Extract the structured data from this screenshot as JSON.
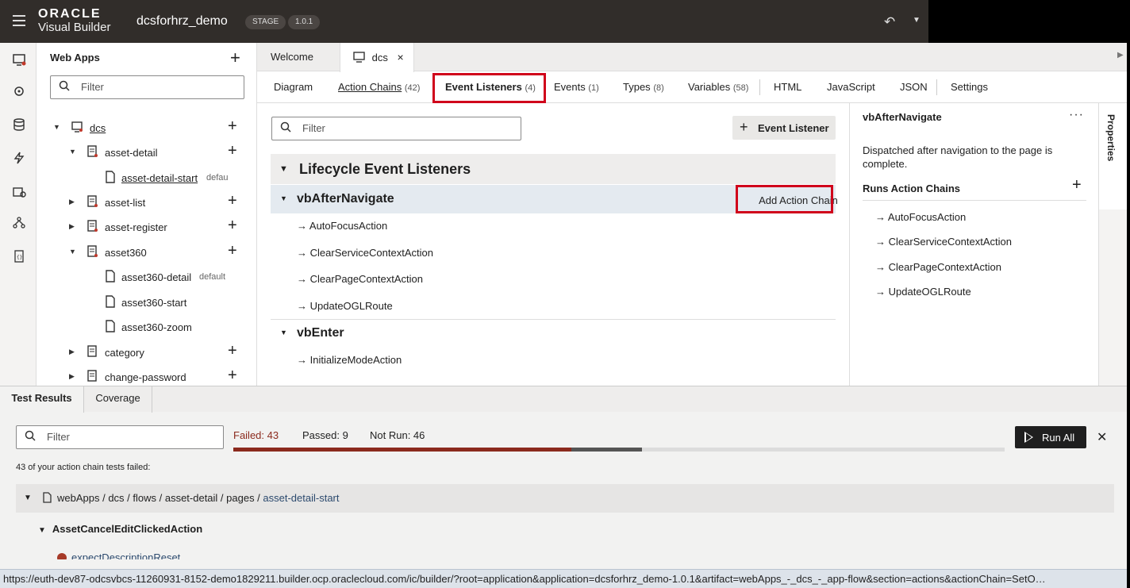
{
  "topbar": {
    "logo_line1": "ORACLE",
    "logo_line2": "Visual Builder",
    "app_name": "dcsforhrz_demo",
    "badge_stage": "STAGE",
    "badge_version": "1.0.1"
  },
  "sidebar": {
    "title": "Web Apps",
    "filter_placeholder": "Filter",
    "items": [
      {
        "label": "dcs"
      },
      {
        "label": "asset-detail"
      },
      {
        "label": "asset-detail-start",
        "note": "defau"
      },
      {
        "label": "asset-list"
      },
      {
        "label": "asset-register"
      },
      {
        "label": "asset360"
      },
      {
        "label": "asset360-detail",
        "note": "default"
      },
      {
        "label": "asset360-start"
      },
      {
        "label": "asset360-zoom"
      },
      {
        "label": "category"
      },
      {
        "label": "change-password"
      }
    ]
  },
  "file_tabs": {
    "welcome": "Welcome",
    "dcs": "dcs",
    "close": "×"
  },
  "sub_tabs": [
    {
      "label": "Diagram",
      "count": ""
    },
    {
      "label": "Action Chains",
      "count": "(42)"
    },
    {
      "label": "Event Listeners",
      "count": "(4)"
    },
    {
      "label": "Events",
      "count": "(1)"
    },
    {
      "label": "Types",
      "count": "(8)"
    },
    {
      "label": "Variables",
      "count": "(58)"
    },
    {
      "label": "HTML",
      "count": ""
    },
    {
      "label": "JavaScript",
      "count": ""
    },
    {
      "label": "JSON",
      "count": ""
    },
    {
      "label": "Settings",
      "count": ""
    }
  ],
  "listeners": {
    "filter_placeholder": "Filter",
    "add_button": "Event Listener",
    "section_title": "Lifecycle Event Listeners",
    "vbAfterNavigate": {
      "name": "vbAfterNavigate",
      "add_chain": "Add Action Chain",
      "chains": [
        "AutoFocusAction",
        "ClearServiceContextAction",
        "ClearPageContextAction",
        "UpdateOGLRoute"
      ]
    },
    "vbEnter": {
      "name": "vbEnter",
      "chains": [
        "InitializeModeAction"
      ]
    }
  },
  "properties": {
    "tab_label": "Properties",
    "title": "vbAfterNavigate",
    "menu": "···",
    "description": "Dispatched after navigation to the page is complete.",
    "runs_label": "Runs Action Chains",
    "chains": [
      "AutoFocusAction",
      "ClearServiceContextAction",
      "ClearPageContextAction",
      "UpdateOGLRoute"
    ]
  },
  "bottom": {
    "tab_results": "Test Results",
    "tab_coverage": "Coverage",
    "filter_placeholder": "Filter",
    "failed": "Failed: 43",
    "passed": "Passed: 9",
    "not_run": "Not Run: 46",
    "failed_count": 43,
    "passed_count": 9,
    "not_run_count": 46,
    "run_all": "Run All",
    "failed_message": "43 of your action chain tests failed:",
    "path_prefix": "webApps / dcs / flows / asset-detail / pages / ",
    "path_page": "asset-detail-start",
    "action_name": "AssetCancelEditClickedAction",
    "cut_text": "expectDescriptionReset"
  },
  "status_url": "https://euth-dev87-odcsvbcs-11260931-8152-demo1829211.builder.ocp.oraclecloud.com/ic/builder/?root=application&application=dcsforhrz_demo-1.0.1&artifact=webApps_-_dcs_-_app-flow&section=actions&actionChain=SetO…",
  "colors": {
    "highlight": "#d0021b",
    "fail_bar": "#8b2a1d",
    "topbar": "#312d2a"
  }
}
